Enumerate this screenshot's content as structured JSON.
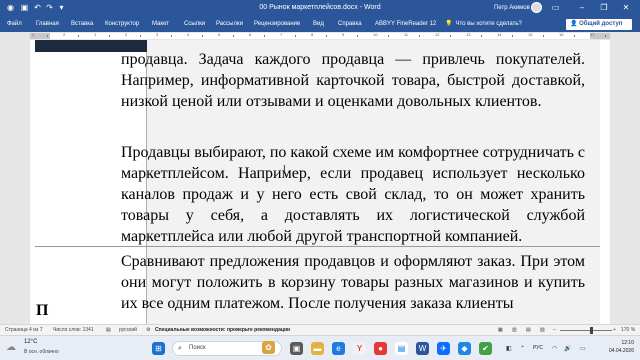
{
  "titlebar": {
    "doc_title": "00 Рынок маркетплейсов.docx  -  Word",
    "user": "Петр Акимов",
    "minimize": "–",
    "restore": "❐",
    "close": "✕"
  },
  "ribbon": {
    "tabs": [
      "Файл",
      "Главная",
      "Вставка",
      "Конструктор",
      "Макет",
      "Ссылки",
      "Рассылки",
      "Рецензирование",
      "Вид",
      "Справка",
      "ABBYY FineReader 12"
    ],
    "tell_me": "Что вы хотите сделать?",
    "share": "Общий доступ"
  },
  "ruler": {
    "numbers": [
      "1",
      "2",
      "1",
      "2",
      "3",
      "4",
      "5",
      "6",
      "7",
      "8",
      "9",
      "10",
      "11",
      "12",
      "13",
      "14",
      "15",
      "16",
      "17"
    ]
  },
  "document": {
    "para1": "продавца. Задача каждого продавца — привлечь покупателей. Например, информативной карточкой товара, быстрой доставкой, низкой ценой или отзывами и оценками довольных клиентов.",
    "para2": "Продавцы выбирают, по какой схеме им комфортнее сотрудничать с маркетплейсом. Например, если продавец использует несколько каналов продаж и у него есть свой склад, то он может хранить товары у себя, а доставлять их логистической службой маркетплейса или любой другой транспортной компанией.",
    "para3": "Сравнивают предложения продавцов и оформляют заказ. При этом они могут положить в корзину товары разных магазинов и купить их все одним платежом. После получения заказа клиенты",
    "left_fragment": "П"
  },
  "statusbar": {
    "page": "Страница 4 из 7",
    "words": "Число слов: 1341",
    "language": "русский",
    "accessibility": "Специальные возможности: проверьте рекомендации",
    "zoom": "170 %"
  },
  "taskbar": {
    "temperature": "12°C",
    "weather": "В осн. облачно",
    "search": "Поиск",
    "lang": "РУС",
    "time": "12:10",
    "date": "04.04.2026"
  },
  "colors": {
    "word_blue": "#2b579a",
    "table_dark": "#1b2a3f",
    "cell_shade": "#f2f2f2"
  }
}
